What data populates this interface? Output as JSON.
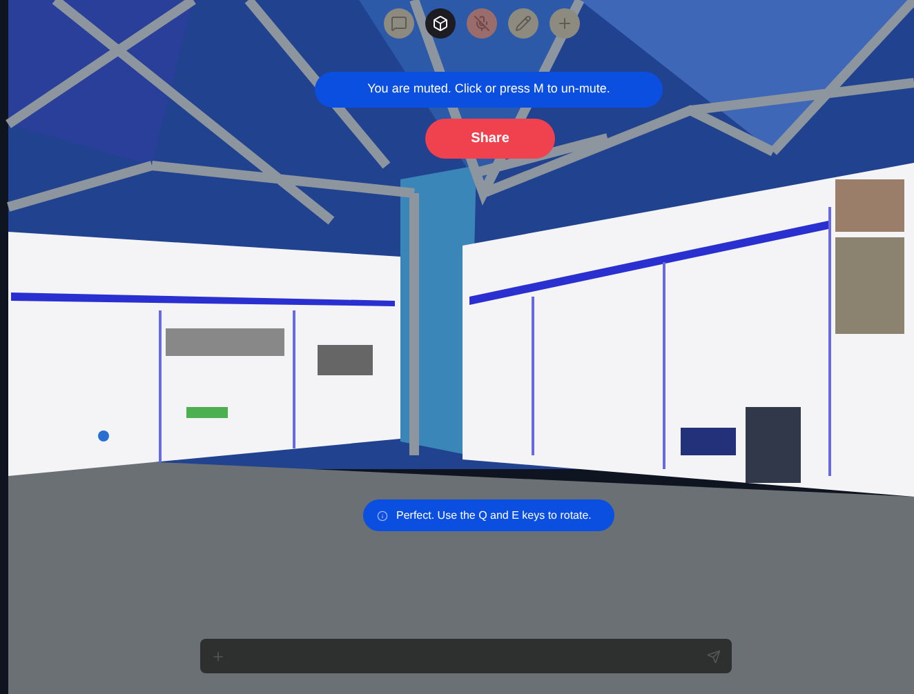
{
  "voice": {
    "muted": true
  },
  "mute_notice": "You are muted. Click or press M to un-mute.",
  "share_button": "Share",
  "rotate_hint": "Perfect. Use the Q and E keys to rotate."
}
